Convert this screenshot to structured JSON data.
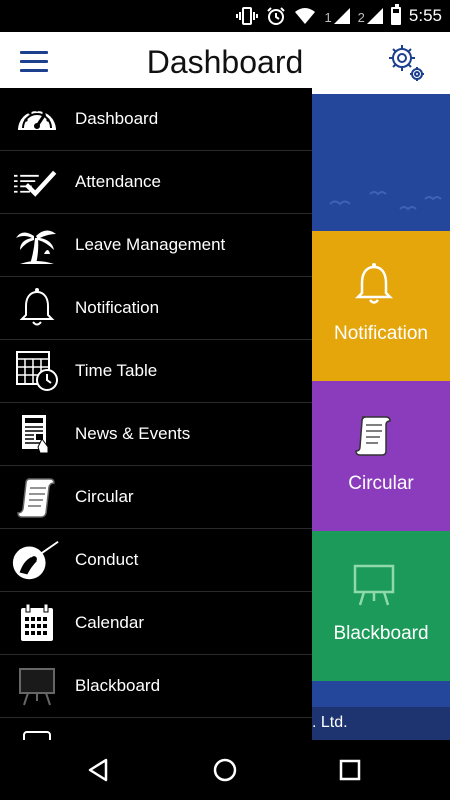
{
  "status_bar": {
    "sim1": "1",
    "sim2": "2",
    "time": "5:55"
  },
  "app_bar": {
    "title": "Dashboard"
  },
  "drawer": {
    "items": [
      {
        "label": "Dashboard",
        "icon": "speedometer-icon"
      },
      {
        "label": "Attendance",
        "icon": "checklist-icon"
      },
      {
        "label": "Leave Management",
        "icon": "palm-tree-icon"
      },
      {
        "label": "Notification",
        "icon": "bell-icon"
      },
      {
        "label": "Time Table",
        "icon": "calendar-clock-icon"
      },
      {
        "label": "News & Events",
        "icon": "newspaper-icon"
      },
      {
        "label": "Circular",
        "icon": "scroll-icon"
      },
      {
        "label": "Conduct",
        "icon": "conductor-icon"
      },
      {
        "label": "Calendar",
        "icon": "calendar-icon"
      },
      {
        "label": "Blackboard",
        "icon": "blackboard-icon"
      }
    ]
  },
  "tiles": {
    "notification": {
      "label": "Notification",
      "color": "#e5a60c"
    },
    "circular": {
      "label": "Circular",
      "color": "#8a3cbd"
    },
    "blackboard": {
      "label": "Blackboard",
      "color": "#1b9a59"
    }
  },
  "footer": {
    "text": ". Ltd."
  },
  "colors": {
    "accent": "#1c3f8f",
    "banner": "#24479b"
  }
}
